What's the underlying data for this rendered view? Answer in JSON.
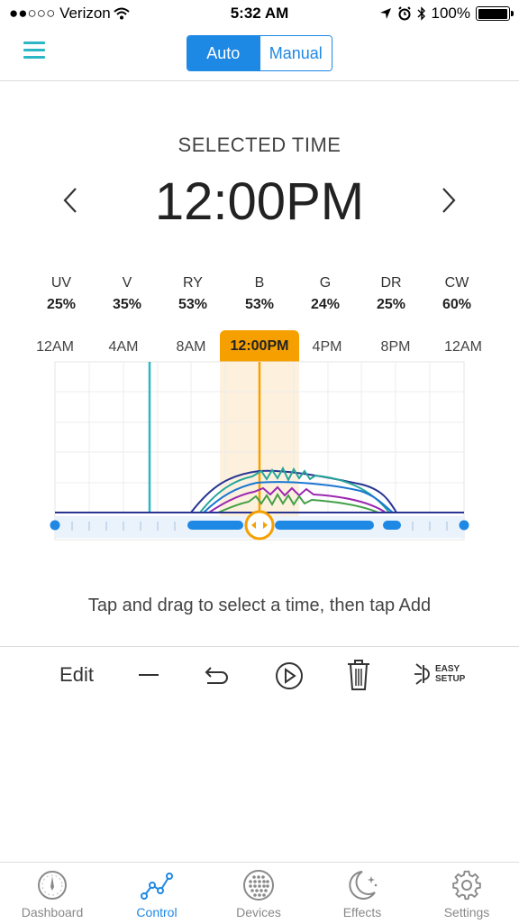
{
  "status_bar": {
    "carrier": "●●○○○ Verizon",
    "time": "5:32 AM",
    "battery": "100%",
    "battery_level": 1.0
  },
  "header": {
    "segments": [
      {
        "label": "Auto",
        "selected": true
      },
      {
        "label": "Manual",
        "selected": false
      }
    ]
  },
  "selected": {
    "label": "SELECTED TIME",
    "time": "12:00PM"
  },
  "channels": [
    {
      "name": "UV",
      "value": "25%"
    },
    {
      "name": "V",
      "value": "35%"
    },
    {
      "name": "RY",
      "value": "53%"
    },
    {
      "name": "B",
      "value": "53%"
    },
    {
      "name": "G",
      "value": "24%"
    },
    {
      "name": "DR",
      "value": "25%"
    },
    {
      "name": "CW",
      "value": "60%"
    }
  ],
  "timeline": {
    "ticks": [
      "12AM",
      "4AM",
      "8AM",
      "12:00PM",
      "4PM",
      "8PM",
      "12AM"
    ],
    "selected_tick": "12:00PM"
  },
  "hint": "Tap and drag to select a time, then tap Add",
  "toolbar": {
    "edit": "Edit",
    "icons": [
      "minus-icon",
      "undo-icon",
      "play-icon",
      "trash-icon",
      "easy-setup-icon"
    ],
    "easy_setup_line1": "EASY",
    "easy_setup_line2": "SETUP"
  },
  "tabs": [
    {
      "label": "Dashboard",
      "icon": "gauge-icon",
      "active": false
    },
    {
      "label": "Control",
      "icon": "graph-icon",
      "active": true
    },
    {
      "label": "Devices",
      "icon": "devices-icon",
      "active": false
    },
    {
      "label": "Effects",
      "icon": "moon-icon",
      "active": false
    },
    {
      "label": "Settings",
      "icon": "gear-icon",
      "active": false
    }
  ],
  "colors": {
    "accent": "#1e88e5",
    "teal": "#2bb8c4",
    "selection": "#f5a000"
  }
}
